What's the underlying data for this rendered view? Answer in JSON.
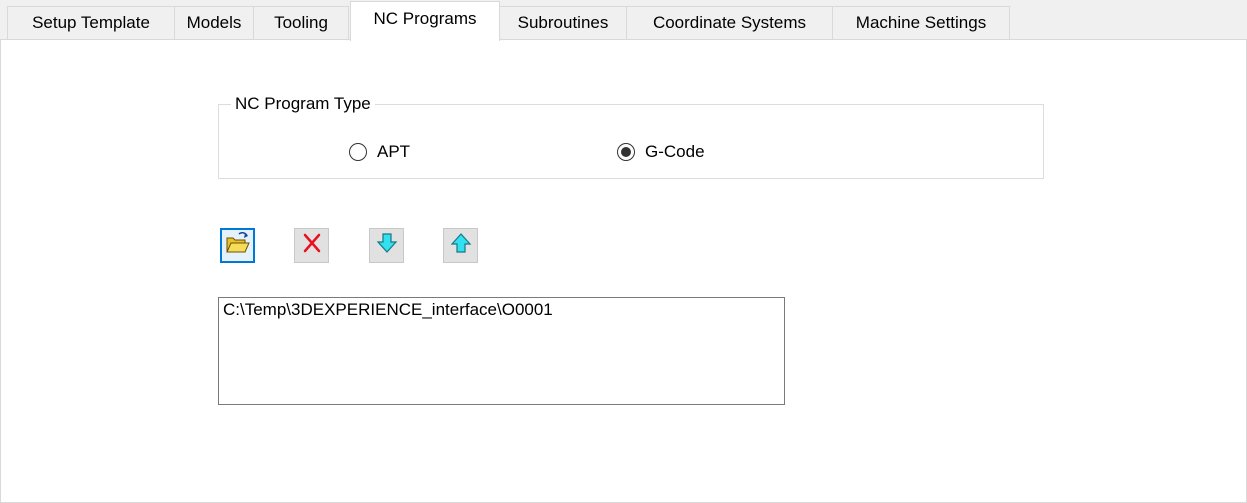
{
  "tabs": [
    {
      "label": "Setup Template",
      "active": false
    },
    {
      "label": "Models",
      "active": false
    },
    {
      "label": "Tooling",
      "active": false
    },
    {
      "label": "NC Programs",
      "active": true
    },
    {
      "label": "Subroutines",
      "active": false
    },
    {
      "label": "Coordinate Systems",
      "active": false
    },
    {
      "label": "Machine Settings",
      "active": false
    }
  ],
  "program_type": {
    "legend": "NC Program Type",
    "options": [
      {
        "label": "APT",
        "selected": false
      },
      {
        "label": "G-Code",
        "selected": true
      }
    ]
  },
  "toolbar": {
    "buttons": [
      {
        "icon": "open-folder-icon",
        "focused": true
      },
      {
        "icon": "delete-x-icon",
        "focused": false
      },
      {
        "icon": "move-down-arrow-icon",
        "focused": false
      },
      {
        "icon": "move-up-arrow-icon",
        "focused": false
      }
    ]
  },
  "program_list": {
    "items": [
      "C:\\Temp\\3DEXPERIENCE_interface\\O0001"
    ]
  },
  "colors": {
    "focus_border": "#0078d7",
    "delete_red": "#e81123",
    "arrow_cyan": "#33e0f0",
    "folder_yellow": "#f5d64f"
  }
}
